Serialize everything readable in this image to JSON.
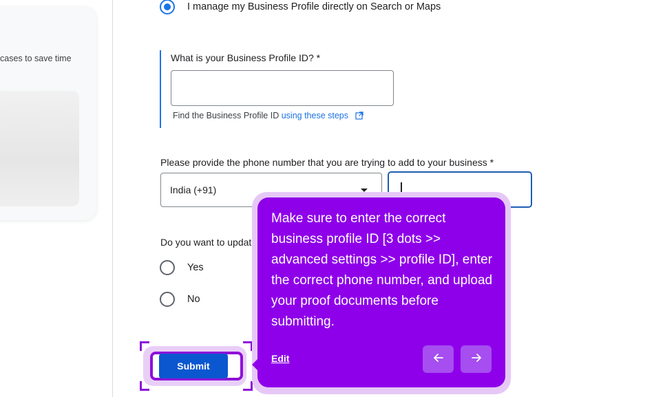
{
  "left_panel": {
    "card_text": "cases to save time"
  },
  "form": {
    "manage_option": {
      "label": "I manage my Business Profile directly on Search or Maps",
      "selected": true
    },
    "profile_id": {
      "label": "What is your Business Profile ID? *",
      "value": "",
      "helper_prefix": "Find the Business Profile ID ",
      "helper_link": "using these steps"
    },
    "phone": {
      "label": "Please provide the phone number that you are trying to add to your business *",
      "country_selected": "India (+91)",
      "value": ""
    },
    "update_question": {
      "label": "Do you want to updat",
      "options": [
        {
          "label": "Yes",
          "selected": false
        },
        {
          "label": "No",
          "selected": false
        }
      ]
    },
    "submit_label": "Submit"
  },
  "tooltip": {
    "text": "Make sure to enter the correct business profile ID [3 dots >> advanced settings >> profile ID], enter the correct phone number, and upload your proof documents before submitting.",
    "edit_label": "Edit",
    "prev_icon": "arrow-left-icon",
    "next_icon": "arrow-right-icon"
  },
  "colors": {
    "accent_blue": "#1a73e8",
    "submit_blue": "#0b57d0",
    "tooltip_purple": "#8e00e9",
    "highlight_purple": "#8e0fd9"
  }
}
